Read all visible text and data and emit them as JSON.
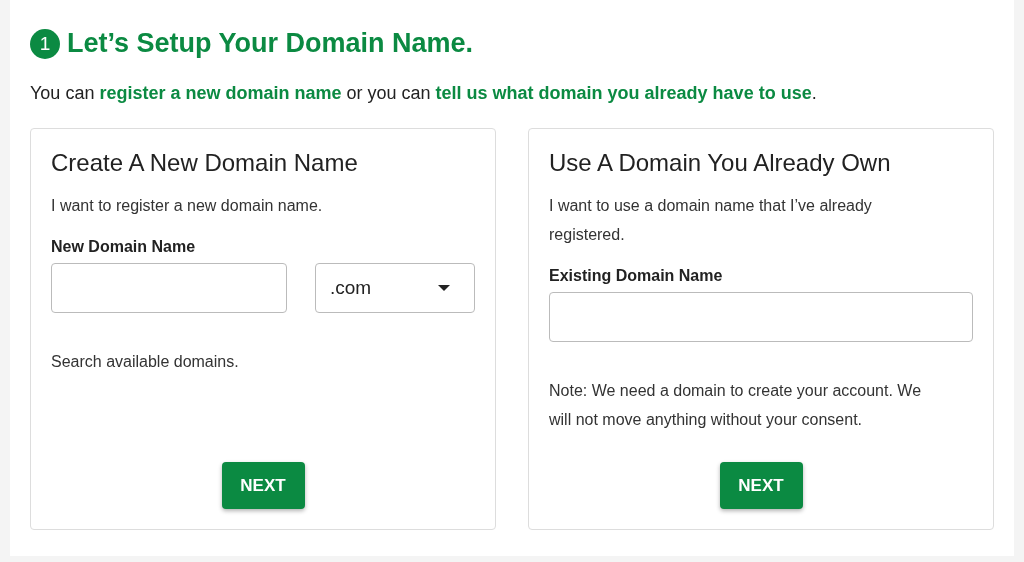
{
  "step_number": "1",
  "title": "Let’s Setup Your Domain Name.",
  "intro": [
    {
      "kind": "text",
      "text": "You can "
    },
    {
      "kind": "link",
      "text": "register a new domain name"
    },
    {
      "kind": "text",
      "text": " or you can "
    },
    {
      "kind": "link",
      "text": "tell us what domain you already have to use"
    },
    {
      "kind": "text",
      "text": "."
    }
  ],
  "cards": [
    {
      "kind": "new",
      "heading": "Create A New Domain Name",
      "description": "I want to register a new domain name.",
      "field_label": "New Domain Name",
      "tld_select": {
        "value": ".com"
      },
      "note": "Search available domains.",
      "button": "NEXT"
    },
    {
      "kind": "existing",
      "heading": "Use A Domain You Already Own",
      "description": "I want to use a domain name that I’ve already registered.",
      "field_label": "Existing Domain Name",
      "note": "Note: We need a domain to create your account. We will not move anything without your consent.",
      "button": "NEXT"
    }
  ]
}
